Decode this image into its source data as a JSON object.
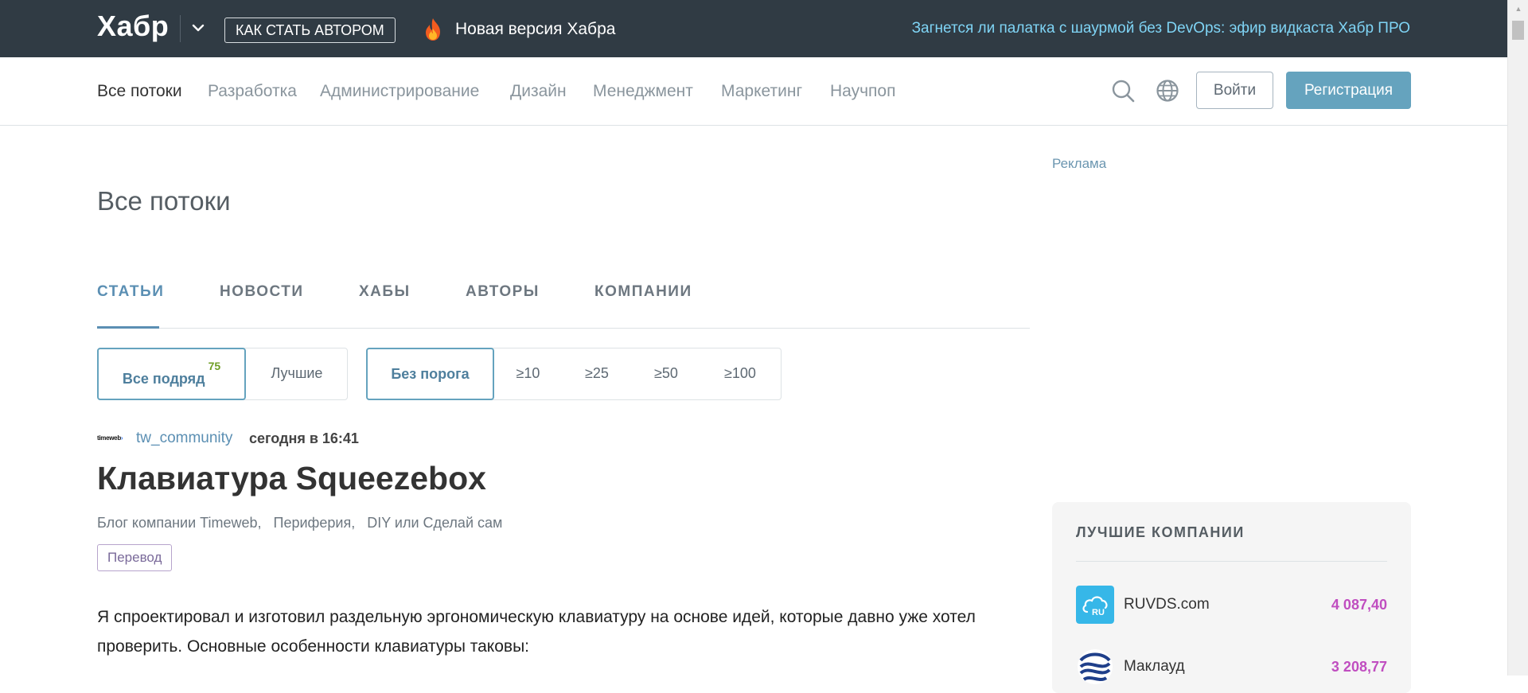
{
  "topbar": {
    "logo": "Хабр",
    "author_button": "КАК СТАТЬ АВТОРОМ",
    "new_version": "Новая версия Хабра",
    "promo": "Загнется ли палатка с шаурмой без DevOps: эфир видкаста Хабр ПРО"
  },
  "nav": {
    "items": [
      "Все потоки",
      "Разработка",
      "Администрирование",
      "Дизайн",
      "Менеджмент",
      "Маркетинг",
      "Научпоп"
    ],
    "login": "Войти",
    "register": "Регистрация"
  },
  "ad_label": "Реклама",
  "page_title": "Все потоки",
  "tabs": [
    "СТАТЬИ",
    "НОВОСТИ",
    "ХАБЫ",
    "АВТОРЫ",
    "КОМПАНИИ"
  ],
  "filters": {
    "sort": {
      "all": "Все подряд",
      "all_count": "75",
      "best": "Лучшие"
    },
    "threshold": [
      "Без порога",
      "≥10",
      "≥25",
      "≥50",
      "≥100"
    ]
  },
  "post": {
    "company_logo_text": "timeweb",
    "author": "tw_community",
    "time": "сегодня в 16:41",
    "title": "Клавиатура Squeezebox",
    "hubs": [
      "Блог компании Timeweb,",
      "Периферия,",
      "DIY или Сделай сам"
    ],
    "badge": "Перевод",
    "text": "Я спроектировал и изготовил раздельную эргономическую клавиатуру на основе идей, которые давно уже хотел проверить. Основные особенности клавиатуры таковы:"
  },
  "sidebar": {
    "title": "ЛУЧШИЕ КОМПАНИИ",
    "companies": [
      {
        "name": "RUVDS.com",
        "score": "4 087,40",
        "icon": "ruvds-cloud-icon"
      },
      {
        "name": "Маклауд",
        "score": "3 208,77",
        "icon": "macloud-logo-icon"
      }
    ]
  },
  "colors": {
    "topbar": "#303b44",
    "accent": "#65a3be",
    "score": "#c04ec0"
  }
}
